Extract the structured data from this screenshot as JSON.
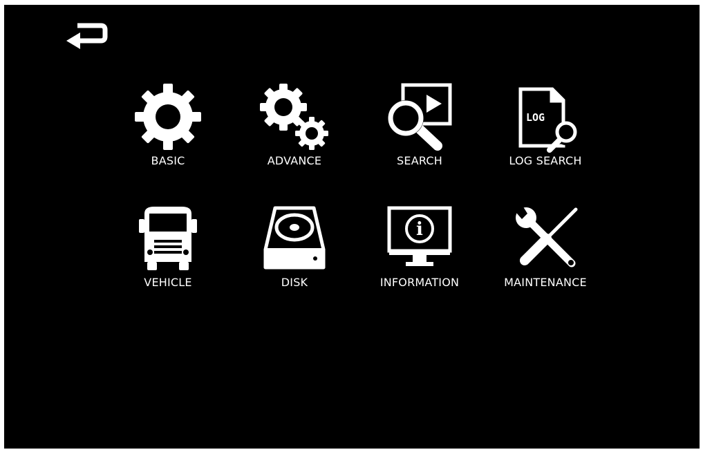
{
  "screen": {
    "background": "#000000",
    "foreground": "#ffffff"
  },
  "back_button": {
    "icon": "return-arrow-icon"
  },
  "menu": {
    "items": [
      {
        "label": "BASIC",
        "icon": "gear-icon"
      },
      {
        "label": "ADVANCE",
        "icon": "gears-icon"
      },
      {
        "label": "SEARCH",
        "icon": "video-search-icon"
      },
      {
        "label": "LOG SEARCH",
        "icon": "log-search-icon",
        "icon_text": "LOG"
      },
      {
        "label": "VEHICLE",
        "icon": "truck-icon"
      },
      {
        "label": "DISK",
        "icon": "hard-disk-icon"
      },
      {
        "label": "INFORMATION",
        "icon": "monitor-info-icon",
        "icon_text": "i"
      },
      {
        "label": "MAINTENANCE",
        "icon": "wrench-screwdriver-icon"
      }
    ]
  }
}
